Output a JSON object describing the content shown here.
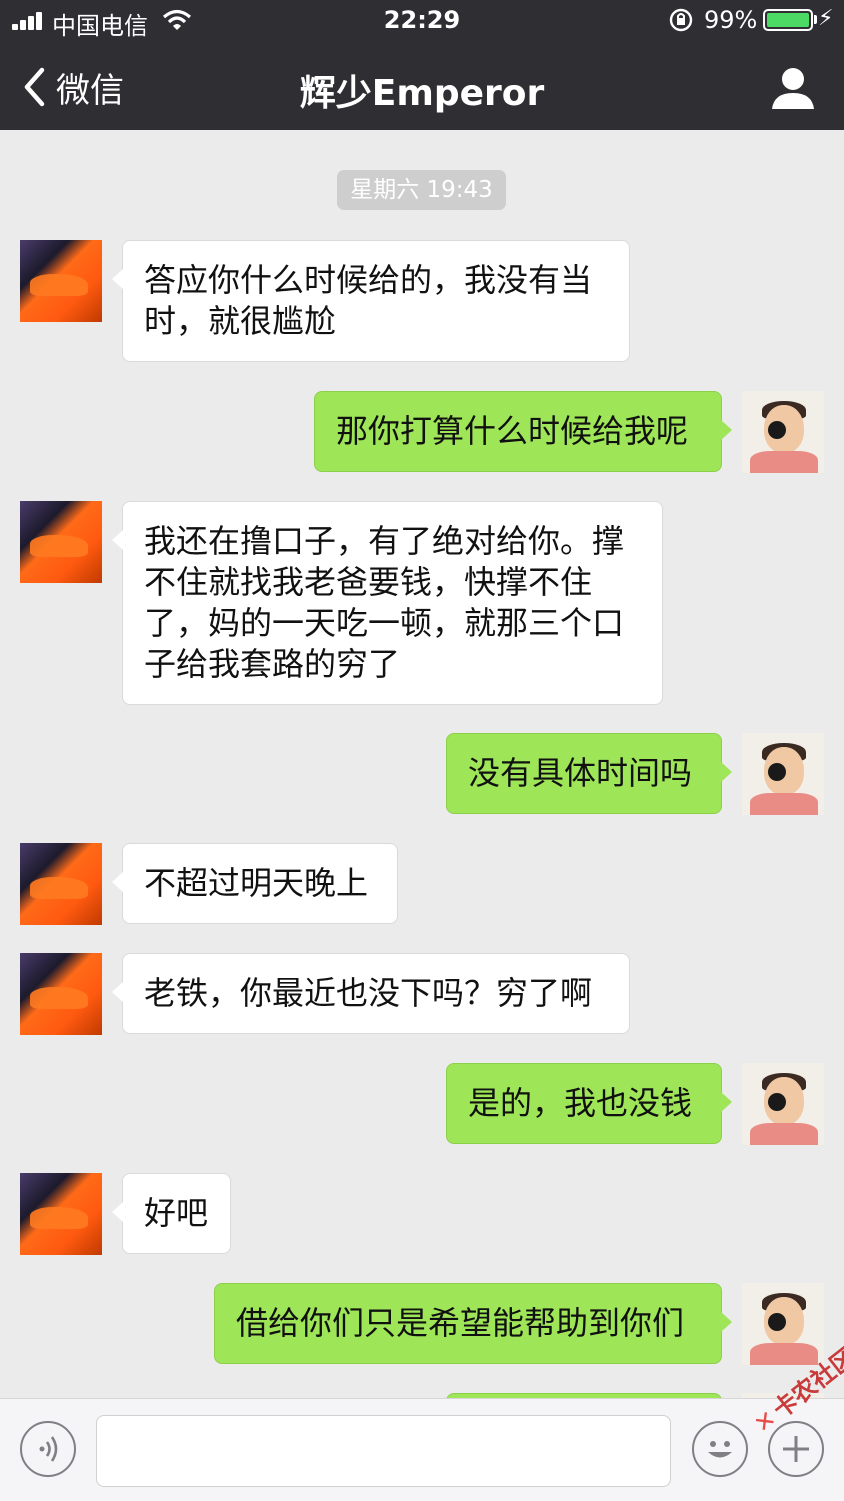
{
  "status_bar": {
    "carrier": "中国电信",
    "time": "22:29",
    "battery_percent": "99%",
    "battery_level": 0.99,
    "battery_color": "#4cd964"
  },
  "nav": {
    "back_label": "微信",
    "title": "辉少Emperor",
    "profile_icon": "person-icon"
  },
  "chat": {
    "timestamp": "星期六 19:43",
    "messages": [
      {
        "side": "in",
        "text": "答应你什么时候给的，我没有当时，就很尴尬"
      },
      {
        "side": "out",
        "text": "那你打算什么时候给我呢"
      },
      {
        "side": "in",
        "text": "我还在撸口子，有了绝对给你。撑不住就找我老爸要钱，快撑不住了，妈的一天吃一顿，就那三个口子给我套路的穷了"
      },
      {
        "side": "out",
        "text": "没有具体时间吗"
      },
      {
        "side": "in",
        "text": "不超过明天晚上"
      },
      {
        "side": "in",
        "text": "老铁，你最近也没下吗？穷了啊"
      },
      {
        "side": "out",
        "text": "是的，我也没钱"
      },
      {
        "side": "in",
        "text": "好吧"
      },
      {
        "side": "out",
        "text": "借给你们只是希望能帮助到你们"
      },
      {
        "side": "out",
        "text": ""
      }
    ]
  },
  "input_bar": {
    "voice_icon": "voice-icon",
    "emoji_icon": "emoji-icon",
    "plus_icon": "plus-icon"
  },
  "watermark": "卡农社区",
  "colors": {
    "header_bg": "#2e2e33",
    "chat_bg": "#ebebeb",
    "outgoing_bubble": "#9ee658",
    "incoming_bubble": "#ffffff"
  }
}
